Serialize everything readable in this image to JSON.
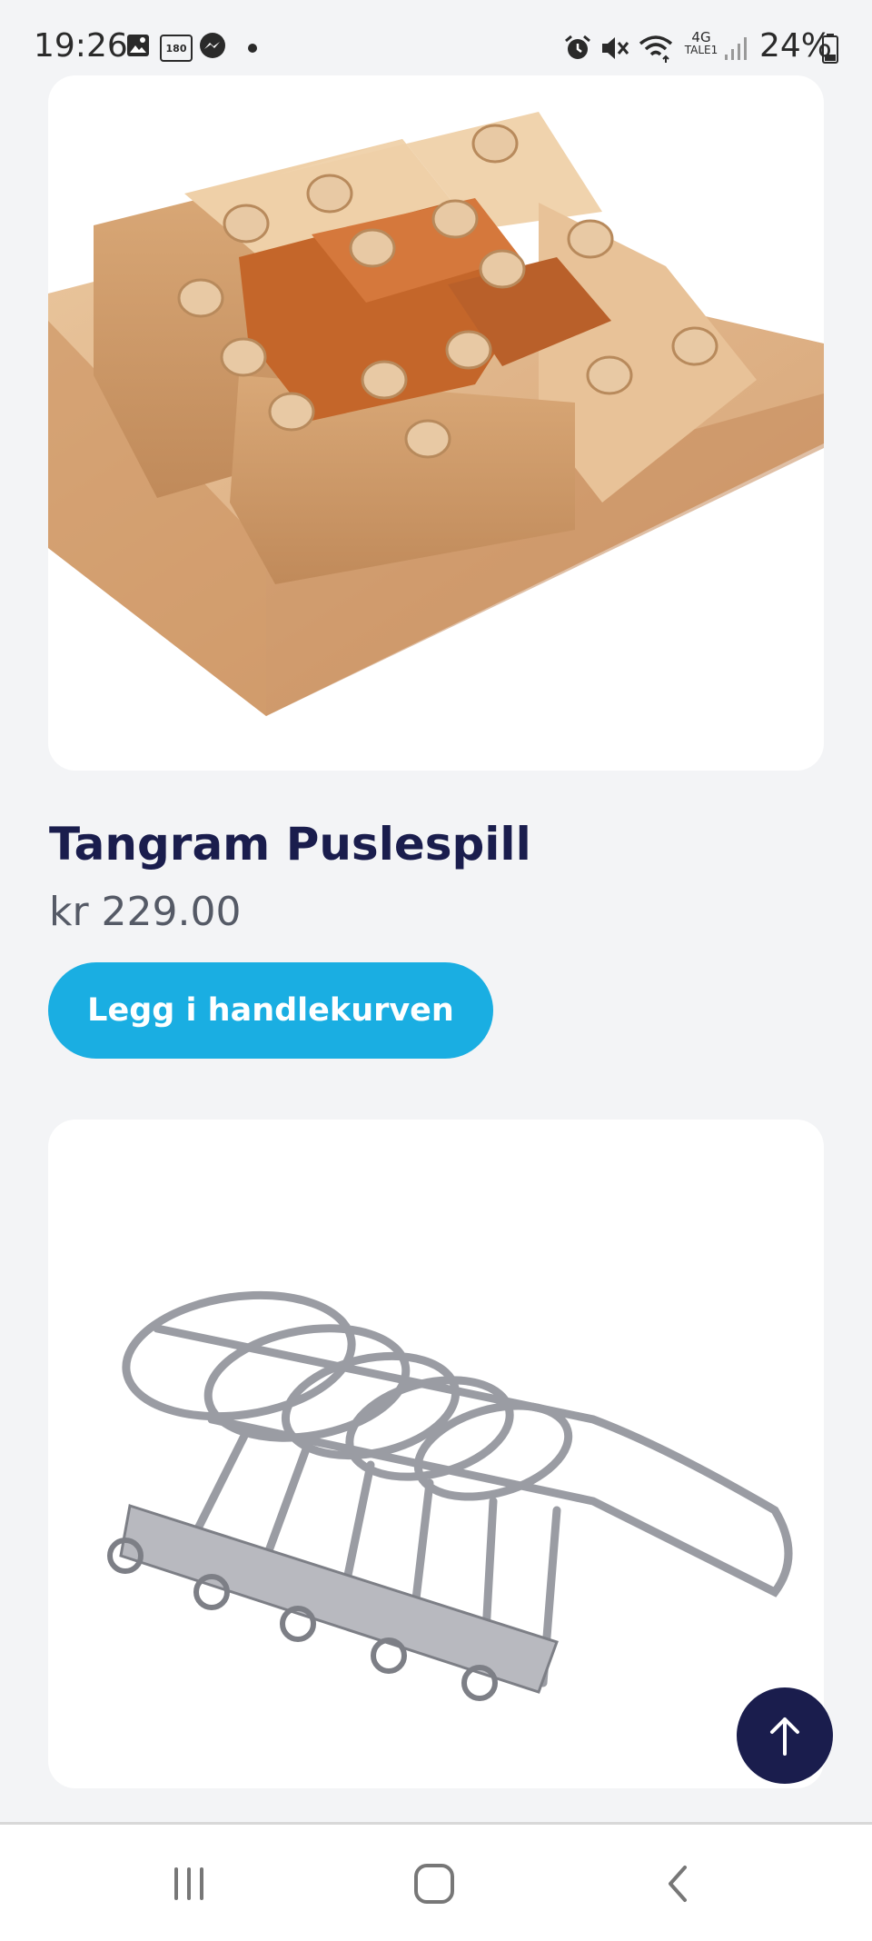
{
  "status_bar": {
    "time": "19:26",
    "battery_percent": "24%",
    "network_label": "4G",
    "network_sublabel": "TALE1",
    "badge": "180"
  },
  "products": [
    {
      "title": "Tangram Puslespill",
      "price": "kr 229.00",
      "cart_label": "Legg i handlekurven",
      "image": "wooden-puzzle"
    },
    {
      "image": "metal-ring-puzzle"
    }
  ],
  "colors": {
    "background": "#f3f4f6",
    "title": "#1a1d4d",
    "button": "#1aaee2",
    "fab": "#1a1d4d"
  },
  "icons": [
    "gallery-icon",
    "badge-180-icon",
    "messenger-icon",
    "alarm-icon",
    "mute-icon",
    "wifi-icon",
    "signal-icon",
    "battery-icon",
    "arrow-up-icon",
    "recent-apps-icon",
    "home-icon",
    "back-icon"
  ]
}
